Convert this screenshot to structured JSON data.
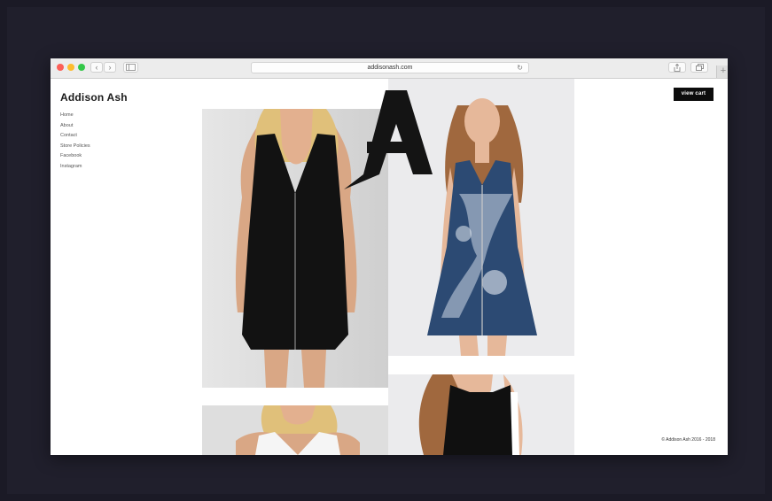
{
  "browser": {
    "url": "addisonash.com",
    "newtab_label": "+"
  },
  "site": {
    "brand": "Addison Ash",
    "nav": [
      "Home",
      "About",
      "Contact",
      "Store Policies",
      "Facebook",
      "Instagram"
    ],
    "cart_label": "view cart",
    "copyright": "© Addison Ash 2016 - 2018"
  },
  "products": [
    {
      "desc": "black zip-front dress",
      "dress_color": "#111111"
    },
    {
      "desc": "blue tie-dye zip-front dress",
      "dress_color": "#2c4a73"
    },
    {
      "desc": "white sleeveless top",
      "dress_color": "#f2f2f2"
    },
    {
      "desc": "black sleeveless top",
      "dress_color": "#101010"
    }
  ],
  "colors": {
    "backdrop": "#1b1a26",
    "toolbar": "#ececec",
    "cart_button": "#0c0c0c"
  }
}
